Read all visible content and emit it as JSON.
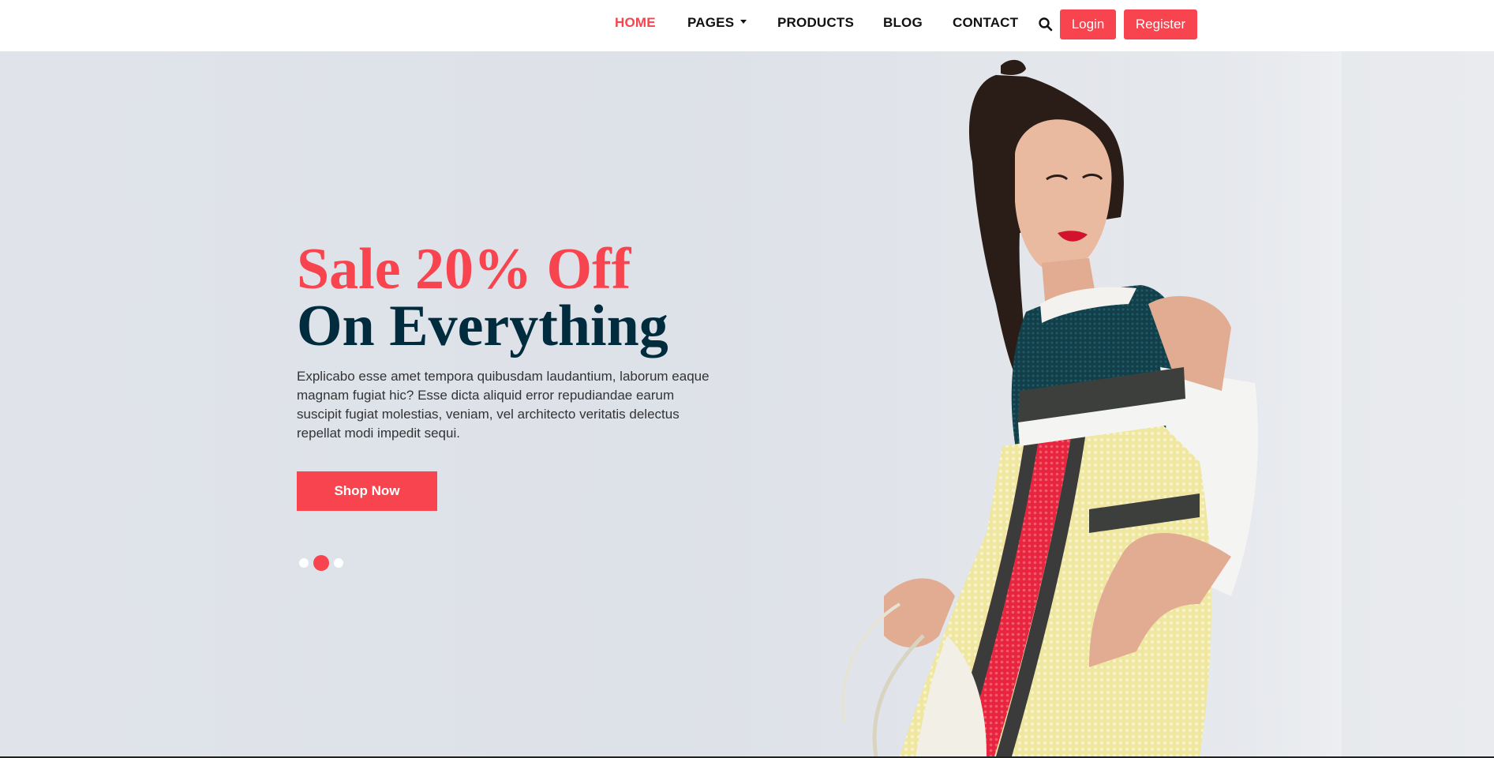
{
  "nav": {
    "items": [
      {
        "label": "HOME",
        "active": true
      },
      {
        "label": "PAGES",
        "dropdown": true
      },
      {
        "label": "PRODUCTS"
      },
      {
        "label": "BLOG"
      },
      {
        "label": "CONTACT"
      }
    ],
    "search_icon": "search-icon",
    "login_label": "Login",
    "register_label": "Register"
  },
  "hero": {
    "headline_line1": "Sale 20% Off",
    "headline_line2": "On Everything",
    "description": "Explicabo esse amet tempora quibusdam laudantium, laborum eaque magnam fugiat hic? Esse dicta aliquid error repudiandae earum suscipit fugiat molestias, veniam, vel architecto veritatis delectus repellat modi impedit sequi.",
    "cta_label": "Shop Now",
    "slides_total": 3,
    "active_slide": 2,
    "image": "fashion-model-photo"
  },
  "colors": {
    "accent": "#f7444e",
    "headline_dark": "#002c3e",
    "hero_background": "#e0e4ea",
    "nav_text": "#111111"
  }
}
